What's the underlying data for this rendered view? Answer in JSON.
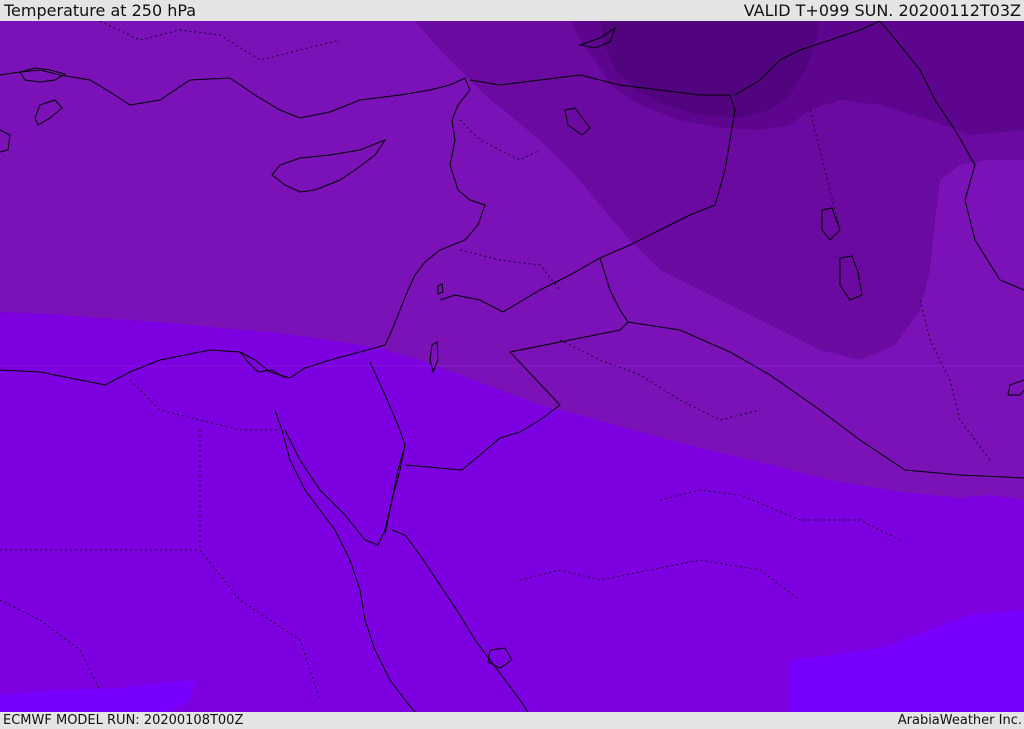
{
  "header": {
    "title": "Temperature at 250 hPa",
    "valid": "VALID T+099 SUN. 20200112T03Z"
  },
  "footer": {
    "model_run": "ECMWF MODEL RUN: 20200108T00Z",
    "credit": "ArabiaWeather Inc."
  },
  "colors": {
    "warmest_band": "#7800ff",
    "warm_band": "#7d00e0",
    "mid_band": "#7a12b8",
    "cool_band": "#6a0aa0",
    "cold_band": "#5e0590",
    "coldest_core": "#52037e",
    "coastline": "#000000",
    "borders": "#1a0030"
  },
  "map": {
    "field": "Temperature",
    "level": "250 hPa",
    "region": "Eastern Mediterranean / Middle East"
  }
}
